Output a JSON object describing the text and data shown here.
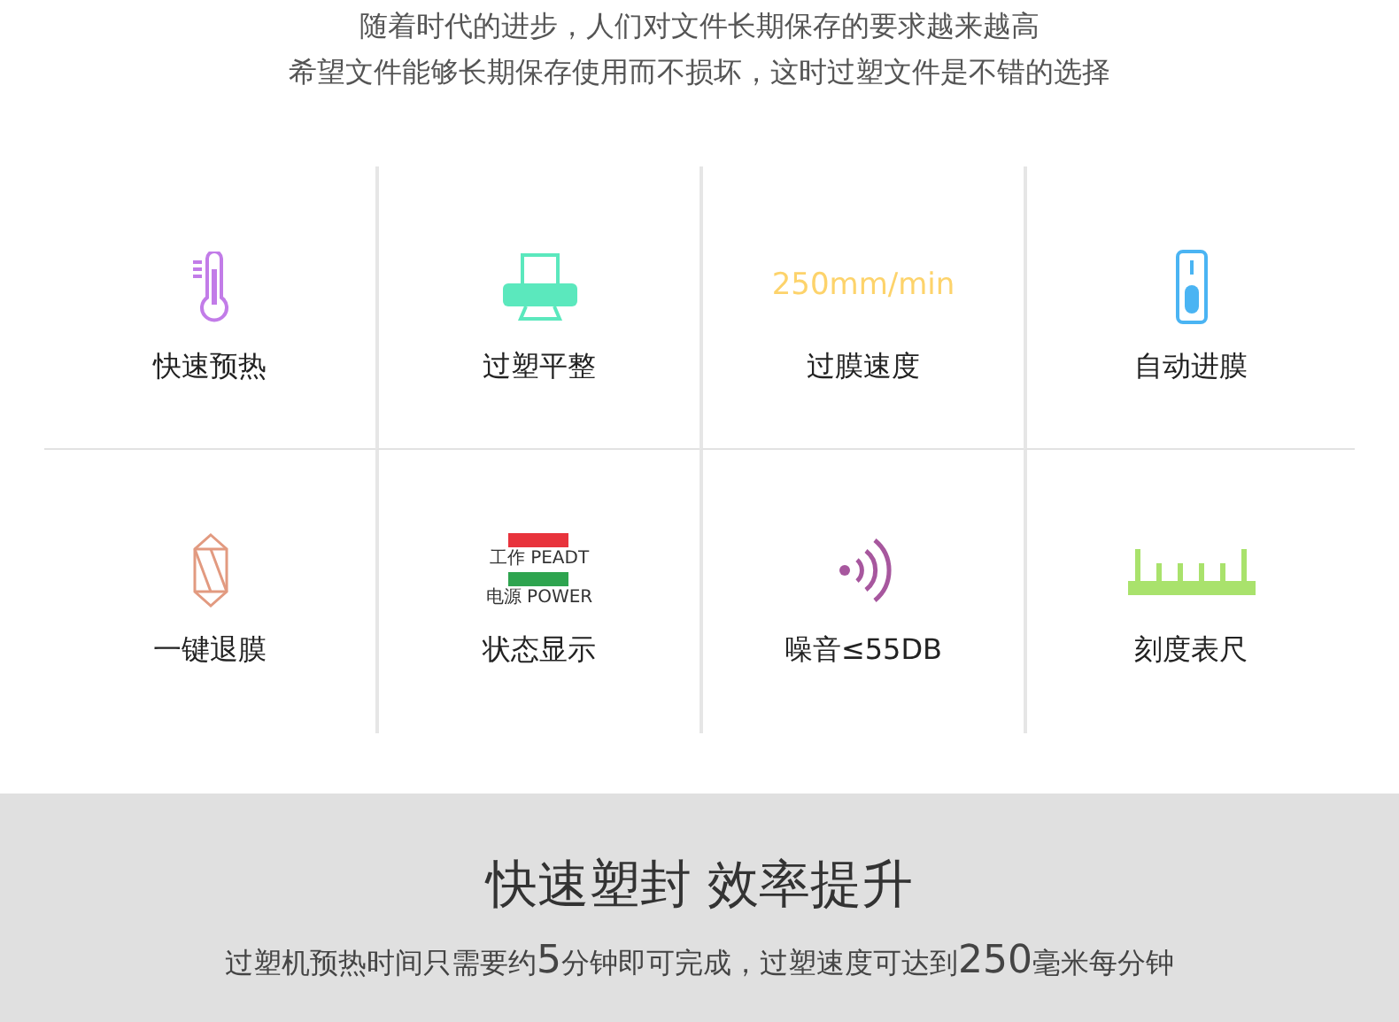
{
  "intro": [
    "随着时代的进步，人们对文件长期保存的要求越来越高",
    "希望文件能够长期保存使用而不损坏，这时过塑文件是不错的选择"
  ],
  "features": [
    {
      "kind": "thermometer",
      "label": "快速预热"
    },
    {
      "kind": "printer",
      "label": "过塑平整"
    },
    {
      "kind": "speed",
      "value": "250mm/min",
      "label": "过膜速度"
    },
    {
      "kind": "slider",
      "label": "自动进膜"
    },
    {
      "kind": "prism",
      "label": "一键退膜"
    },
    {
      "kind": "status",
      "lights": [
        {
          "text": "工作 PEADT",
          "color": "#e8333c"
        },
        {
          "text": "电源 POWER",
          "color": "#2ea44f"
        }
      ],
      "label": "状态显示"
    },
    {
      "kind": "signal",
      "label": "噪音≤55DB"
    },
    {
      "kind": "ruler",
      "label": "刻度表尺"
    }
  ],
  "section": {
    "title": "快速塑封 效率提升",
    "body": [
      {
        "text": "过塑机预热时间只需要约",
        "big": false
      },
      {
        "text": "5",
        "big": true
      },
      {
        "text": "分钟即可完成，过塑速度可达到",
        "big": false
      },
      {
        "text": "250",
        "big": true
      },
      {
        "text": "毫米每分钟",
        "big": false
      }
    ]
  }
}
